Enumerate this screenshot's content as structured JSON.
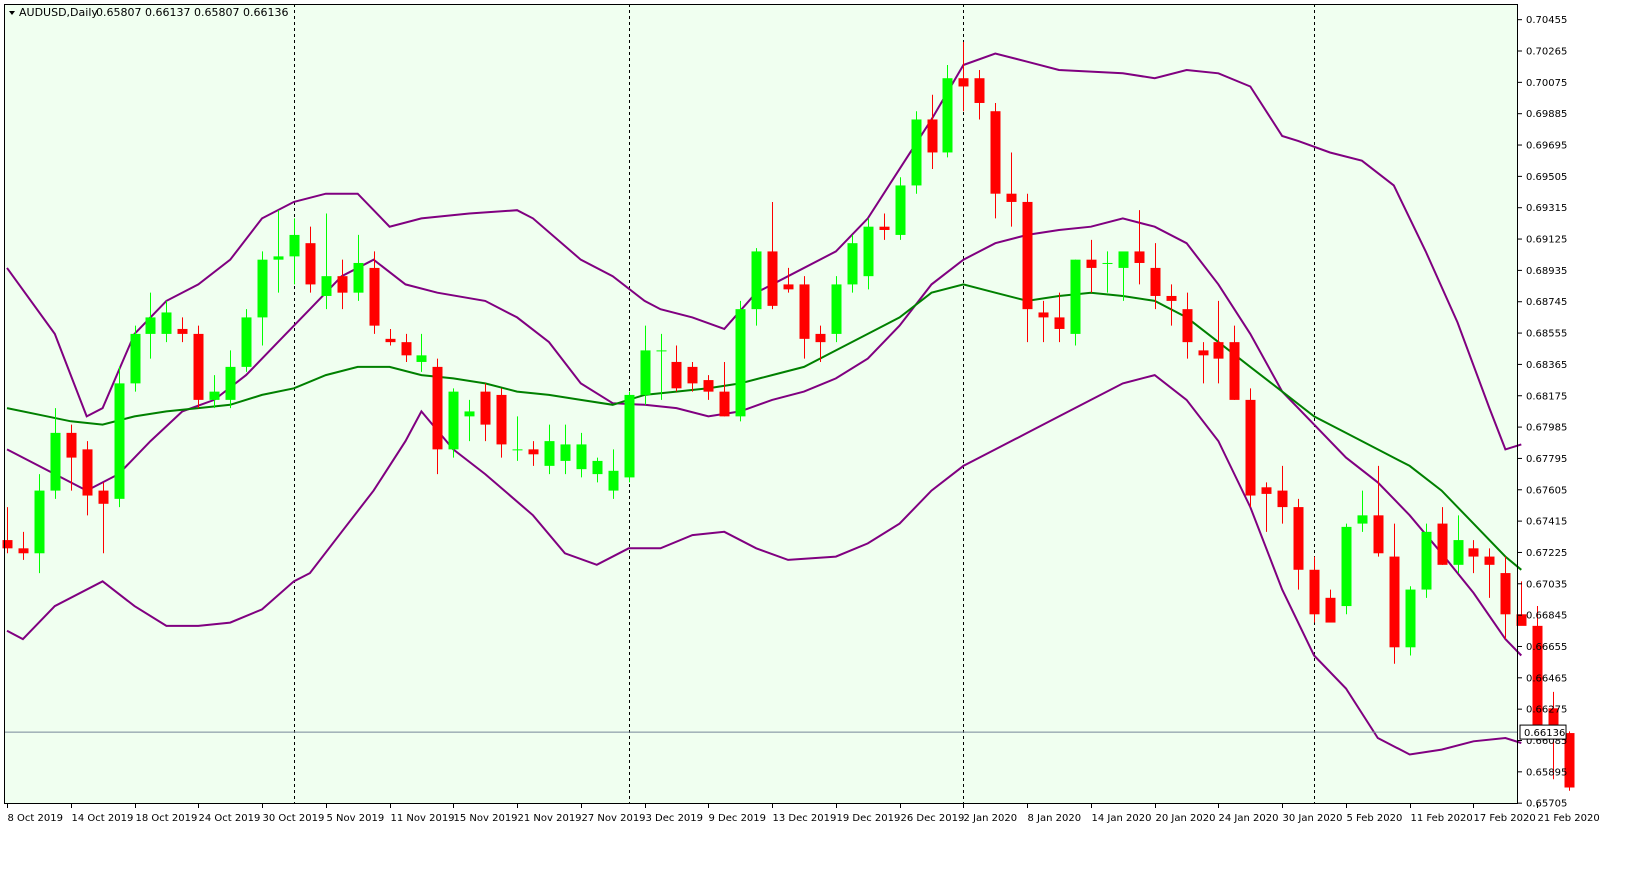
{
  "header": {
    "symbol": "AUDUSD,Daily",
    "ohlc": "0.65807 0.66137 0.65807 0.66136"
  },
  "colors": {
    "background": "#F0FFF0",
    "bull": "#00FF00",
    "bear": "#FF0000",
    "band": "#800080",
    "ma": "#008000",
    "grid": "#000000",
    "price_line": "#778899"
  },
  "chart_data": {
    "type": "candlestick",
    "title": "AUDUSD,Daily",
    "ylim": [
      0.657,
      0.7055
    ],
    "y_ticks": [
      "0.70455",
      "0.70265",
      "0.70075",
      "0.69885",
      "0.69695",
      "0.69505",
      "0.69315",
      "0.69125",
      "0.68935",
      "0.68745",
      "0.68555",
      "0.68365",
      "0.68175",
      "0.67985",
      "0.67795",
      "0.67605",
      "0.67415",
      "0.67225",
      "0.67035",
      "0.66845",
      "0.66655",
      "0.66465",
      "0.66275",
      "0.66085",
      "0.65895",
      "0.65705"
    ],
    "x_tick_labels": [
      "8 Oct 2019",
      "14 Oct 2019",
      "18 Oct 2019",
      "24 Oct 2019",
      "30 Oct 2019",
      "5 Nov 2019",
      "11 Nov 2019",
      "15 Nov 2019",
      "21 Nov 2019",
      "27 Nov 2019",
      "3 Dec 2019",
      "9 Dec 2019",
      "13 Dec 2019",
      "19 Dec 2019",
      "26 Dec 2019",
      "2 Jan 2020",
      "8 Jan 2020",
      "14 Jan 2020",
      "20 Jan 2020",
      "24 Jan 2020",
      "30 Jan 2020",
      "5 Feb 2020",
      "11 Feb 2020",
      "17 Feb 2020",
      "21 Feb 2020"
    ],
    "x_tick_index": [
      0,
      4,
      8,
      12,
      16,
      20,
      24,
      28,
      32,
      36,
      40,
      44,
      48,
      52,
      56,
      60,
      64,
      68,
      72,
      76,
      80,
      84,
      88,
      92,
      96
    ],
    "separators_index": [
      18,
      39,
      60,
      82
    ],
    "last_price": "0.66136",
    "last_price_value": 0.66136,
    "candles": [
      [
        0.673,
        0.675,
        0.6722,
        0.6725
      ],
      [
        0.6725,
        0.6735,
        0.6718,
        0.6722
      ],
      [
        0.6722,
        0.677,
        0.671,
        0.676
      ],
      [
        0.676,
        0.681,
        0.6755,
        0.6795
      ],
      [
        0.6795,
        0.68,
        0.676,
        0.678
      ],
      [
        0.6785,
        0.679,
        0.6745,
        0.6757
      ],
      [
        0.676,
        0.6765,
        0.6722,
        0.6752
      ],
      [
        0.6755,
        0.6835,
        0.675,
        0.6825
      ],
      [
        0.6825,
        0.686,
        0.682,
        0.6855
      ],
      [
        0.6855,
        0.688,
        0.684,
        0.6865
      ],
      [
        0.6855,
        0.6875,
        0.685,
        0.6868
      ],
      [
        0.6858,
        0.6865,
        0.685,
        0.6855
      ],
      [
        0.6855,
        0.686,
        0.681,
        0.6815
      ],
      [
        0.6815,
        0.683,
        0.681,
        0.682
      ],
      [
        0.6815,
        0.6845,
        0.681,
        0.6835
      ],
      [
        0.6835,
        0.687,
        0.6832,
        0.6865
      ],
      [
        0.6865,
        0.6905,
        0.6848,
        0.69
      ],
      [
        0.69,
        0.693,
        0.688,
        0.6902
      ],
      [
        0.6902,
        0.6925,
        0.6885,
        0.6915
      ],
      [
        0.691,
        0.692,
        0.688,
        0.6885
      ],
      [
        0.6878,
        0.6928,
        0.687,
        0.689
      ],
      [
        0.689,
        0.69,
        0.687,
        0.688
      ],
      [
        0.688,
        0.6915,
        0.6875,
        0.6898
      ],
      [
        0.6895,
        0.6905,
        0.6855,
        0.686
      ],
      [
        0.6852,
        0.6858,
        0.6848,
        0.685
      ],
      [
        0.685,
        0.6855,
        0.6838,
        0.6842
      ],
      [
        0.6838,
        0.6855,
        0.6832,
        0.6842
      ],
      [
        0.6835,
        0.684,
        0.677,
        0.6785
      ],
      [
        0.6785,
        0.6822,
        0.678,
        0.682
      ],
      [
        0.6805,
        0.6815,
        0.679,
        0.6808
      ],
      [
        0.682,
        0.6825,
        0.679,
        0.68
      ],
      [
        0.6818,
        0.6822,
        0.678,
        0.6788
      ],
      [
        0.6785,
        0.6805,
        0.6778,
        0.6785
      ],
      [
        0.6785,
        0.679,
        0.6775,
        0.6782
      ],
      [
        0.6775,
        0.68,
        0.677,
        0.679
      ],
      [
        0.6778,
        0.68,
        0.677,
        0.6788
      ],
      [
        0.6773,
        0.6795,
        0.6768,
        0.6788
      ],
      [
        0.677,
        0.678,
        0.6765,
        0.6778
      ],
      [
        0.676,
        0.6785,
        0.6755,
        0.6772
      ],
      [
        0.6768,
        0.682,
        0.6765,
        0.6818
      ],
      [
        0.6818,
        0.686,
        0.6812,
        0.6845
      ],
      [
        0.6845,
        0.6855,
        0.6815,
        0.6845
      ],
      [
        0.6838,
        0.6848,
        0.682,
        0.6822
      ],
      [
        0.6835,
        0.6838,
        0.682,
        0.6825
      ],
      [
        0.6827,
        0.683,
        0.6815,
        0.682
      ],
      [
        0.682,
        0.6838,
        0.6805,
        0.6805
      ],
      [
        0.6805,
        0.6875,
        0.6802,
        0.687
      ],
      [
        0.687,
        0.6907,
        0.686,
        0.6905
      ],
      [
        0.6905,
        0.6935,
        0.687,
        0.6872
      ],
      [
        0.6885,
        0.6895,
        0.688,
        0.6882
      ],
      [
        0.6885,
        0.689,
        0.684,
        0.6852
      ],
      [
        0.6855,
        0.686,
        0.6838,
        0.685
      ],
      [
        0.6855,
        0.689,
        0.685,
        0.6885
      ],
      [
        0.6885,
        0.6915,
        0.688,
        0.691
      ],
      [
        0.689,
        0.6925,
        0.6882,
        0.692
      ],
      [
        0.692,
        0.6928,
        0.6912,
        0.6918
      ],
      [
        0.6915,
        0.695,
        0.6912,
        0.6945
      ],
      [
        0.6945,
        0.699,
        0.694,
        0.6985
      ],
      [
        0.6985,
        0.7,
        0.6955,
        0.6965
      ],
      [
        0.6965,
        0.7018,
        0.6962,
        0.701
      ],
      [
        0.701,
        0.7032,
        0.699,
        0.7005
      ],
      [
        0.701,
        0.7015,
        0.6985,
        0.6995
      ],
      [
        0.699,
        0.6995,
        0.6925,
        0.694
      ],
      [
        0.694,
        0.6965,
        0.692,
        0.6935
      ],
      [
        0.6935,
        0.694,
        0.685,
        0.687
      ],
      [
        0.6868,
        0.6875,
        0.685,
        0.6865
      ],
      [
        0.6865,
        0.688,
        0.685,
        0.6858
      ],
      [
        0.6855,
        0.69,
        0.6848,
        0.69
      ],
      [
        0.69,
        0.6912,
        0.688,
        0.6895
      ],
      [
        0.6898,
        0.6905,
        0.688,
        0.6898
      ],
      [
        0.6895,
        0.69,
        0.6875,
        0.6905
      ],
      [
        0.6905,
        0.693,
        0.6885,
        0.6898
      ],
      [
        0.6895,
        0.691,
        0.687,
        0.6878
      ],
      [
        0.6878,
        0.6885,
        0.686,
        0.6875
      ],
      [
        0.687,
        0.688,
        0.684,
        0.685
      ],
      [
        0.6845,
        0.685,
        0.6825,
        0.6842
      ],
      [
        0.685,
        0.6875,
        0.6825,
        0.684
      ],
      [
        0.685,
        0.686,
        0.6815,
        0.6815
      ],
      [
        0.6815,
        0.6822,
        0.675,
        0.6757
      ],
      [
        0.6762,
        0.6765,
        0.6735,
        0.6758
      ],
      [
        0.676,
        0.6775,
        0.674,
        0.675
      ],
      [
        0.675,
        0.6755,
        0.67,
        0.6712
      ],
      [
        0.6712,
        0.672,
        0.668,
        0.6685
      ],
      [
        0.6695,
        0.67,
        0.668,
        0.668
      ],
      [
        0.669,
        0.674,
        0.6685,
        0.6738
      ],
      [
        0.674,
        0.676,
        0.6735,
        0.6745
      ],
      [
        0.6745,
        0.6775,
        0.672,
        0.6722
      ],
      [
        0.672,
        0.674,
        0.6655,
        0.6665
      ],
      [
        0.6665,
        0.6702,
        0.666,
        0.67
      ],
      [
        0.67,
        0.674,
        0.6695,
        0.6735
      ],
      [
        0.674,
        0.675,
        0.6715,
        0.6715
      ],
      [
        0.6715,
        0.6745,
        0.671,
        0.673
      ],
      [
        0.6725,
        0.673,
        0.671,
        0.672
      ],
      [
        0.672,
        0.6725,
        0.6695,
        0.6715
      ],
      [
        0.671,
        0.672,
        0.667,
        0.6685
      ],
      [
        0.6685,
        0.6705,
        0.668,
        0.6678
      ],
      [
        0.6678,
        0.669,
        0.661,
        0.6612
      ],
      [
        0.6628,
        0.6638,
        0.6585,
        0.6615
      ],
      [
        0.6613,
        0.6614,
        0.6578,
        0.658
      ]
    ],
    "bands": {
      "upper": [
        [
          0,
          0.6895
        ],
        [
          3,
          0.6855
        ],
        [
          5,
          0.6805
        ],
        [
          6,
          0.681
        ],
        [
          8,
          0.6855
        ],
        [
          10,
          0.6875
        ],
        [
          12,
          0.6885
        ],
        [
          14,
          0.69
        ],
        [
          16,
          0.6925
        ],
        [
          18,
          0.6935
        ],
        [
          20,
          0.694
        ],
        [
          22,
          0.694
        ],
        [
          24,
          0.692
        ],
        [
          26,
          0.6925
        ],
        [
          29,
          0.6928
        ],
        [
          32,
          0.693
        ],
        [
          33,
          0.6925
        ],
        [
          36,
          0.69
        ],
        [
          38,
          0.689
        ],
        [
          40,
          0.6875
        ],
        [
          41,
          0.687
        ],
        [
          43,
          0.6865
        ],
        [
          45,
          0.6858
        ],
        [
          47,
          0.688
        ],
        [
          49,
          0.689
        ],
        [
          52,
          0.6905
        ],
        [
          54,
          0.6925
        ],
        [
          56,
          0.6955
        ],
        [
          58,
          0.6985
        ],
        [
          60,
          0.7018
        ],
        [
          62,
          0.7025
        ],
        [
          64,
          0.702
        ],
        [
          66,
          0.7015
        ],
        [
          70,
          0.7013
        ],
        [
          72,
          0.701
        ],
        [
          74,
          0.7015
        ],
        [
          76,
          0.7013
        ],
        [
          78,
          0.7005
        ],
        [
          80,
          0.6975
        ],
        [
          81,
          0.6972
        ],
        [
          83,
          0.6965
        ],
        [
          85,
          0.696
        ],
        [
          87,
          0.6945
        ],
        [
          89,
          0.6905
        ],
        [
          91,
          0.6862
        ],
        [
          93,
          0.681
        ],
        [
          94,
          0.6785
        ],
        [
          95,
          0.6788
        ]
      ],
      "lower": [
        [
          0,
          0.6675
        ],
        [
          1,
          0.667
        ],
        [
          3,
          0.669
        ],
        [
          6,
          0.6705
        ],
        [
          8,
          0.669
        ],
        [
          10,
          0.6678
        ],
        [
          12,
          0.6678
        ],
        [
          14,
          0.668
        ],
        [
          16,
          0.6688
        ],
        [
          18,
          0.6705
        ],
        [
          19,
          0.671
        ],
        [
          21,
          0.6735
        ],
        [
          23,
          0.676
        ],
        [
          25,
          0.679
        ],
        [
          26,
          0.6808
        ],
        [
          28,
          0.6785
        ],
        [
          30,
          0.677
        ],
        [
          33,
          0.6745
        ],
        [
          35,
          0.6722
        ],
        [
          37,
          0.6715
        ],
        [
          39,
          0.6725
        ],
        [
          41,
          0.6725
        ],
        [
          43,
          0.6733
        ],
        [
          45,
          0.6735
        ],
        [
          47,
          0.6725
        ],
        [
          49,
          0.6718
        ],
        [
          52,
          0.672
        ],
        [
          54,
          0.6728
        ],
        [
          56,
          0.674
        ],
        [
          58,
          0.676
        ],
        [
          60,
          0.6775
        ],
        [
          62,
          0.6785
        ],
        [
          64,
          0.6795
        ],
        [
          66,
          0.6805
        ],
        [
          68,
          0.6815
        ],
        [
          70,
          0.6825
        ],
        [
          72,
          0.683
        ],
        [
          74,
          0.6815
        ],
        [
          76,
          0.679
        ],
        [
          78,
          0.675
        ],
        [
          80,
          0.67
        ],
        [
          82,
          0.666
        ],
        [
          84,
          0.664
        ],
        [
          86,
          0.661
        ],
        [
          88,
          0.66
        ],
        [
          90,
          0.6603
        ],
        [
          92,
          0.6608
        ],
        [
          94,
          0.661
        ],
        [
          95,
          0.6607
        ]
      ],
      "upper2": [
        [
          0,
          0.6785
        ],
        [
          2,
          0.6775
        ],
        [
          5,
          0.676
        ],
        [
          7,
          0.677
        ],
        [
          9,
          0.679
        ],
        [
          11,
          0.6808
        ],
        [
          13,
          0.6815
        ],
        [
          15,
          0.683
        ],
        [
          17,
          0.685
        ],
        [
          19,
          0.687
        ],
        [
          21,
          0.689
        ],
        [
          23,
          0.69
        ],
        [
          25,
          0.6885
        ],
        [
          27,
          0.688
        ],
        [
          30,
          0.6875
        ],
        [
          32,
          0.6865
        ],
        [
          34,
          0.685
        ],
        [
          36,
          0.6825
        ],
        [
          38,
          0.6813
        ],
        [
          40,
          0.6812
        ],
        [
          42,
          0.681
        ],
        [
          44,
          0.6805
        ],
        [
          46,
          0.6808
        ],
        [
          48,
          0.6815
        ],
        [
          50,
          0.682
        ],
        [
          52,
          0.6828
        ],
        [
          54,
          0.684
        ],
        [
          56,
          0.686
        ],
        [
          58,
          0.6885
        ],
        [
          60,
          0.69
        ],
        [
          62,
          0.691
        ],
        [
          64,
          0.6915
        ],
        [
          66,
          0.6918
        ],
        [
          68,
          0.692
        ],
        [
          70,
          0.6925
        ],
        [
          72,
          0.692
        ],
        [
          74,
          0.691
        ],
        [
          76,
          0.6885
        ],
        [
          78,
          0.6855
        ],
        [
          80,
          0.682
        ],
        [
          82,
          0.68
        ],
        [
          84,
          0.678
        ],
        [
          86,
          0.6765
        ],
        [
          88,
          0.6745
        ],
        [
          90,
          0.6722
        ],
        [
          92,
          0.6698
        ],
        [
          94,
          0.667
        ],
        [
          95,
          0.666
        ]
      ]
    },
    "ma": [
      [
        0,
        0.681
      ],
      [
        2,
        0.6806
      ],
      [
        4,
        0.6802
      ],
      [
        6,
        0.68
      ],
      [
        8,
        0.6805
      ],
      [
        10,
        0.6808
      ],
      [
        12,
        0.681
      ],
      [
        14,
        0.6812
      ],
      [
        16,
        0.6818
      ],
      [
        18,
        0.6822
      ],
      [
        20,
        0.683
      ],
      [
        22,
        0.6835
      ],
      [
        24,
        0.6835
      ],
      [
        26,
        0.683
      ],
      [
        28,
        0.6828
      ],
      [
        30,
        0.6825
      ],
      [
        32,
        0.682
      ],
      [
        34,
        0.6818
      ],
      [
        36,
        0.6815
      ],
      [
        38,
        0.6812
      ],
      [
        40,
        0.6818
      ],
      [
        42,
        0.682
      ],
      [
        44,
        0.6822
      ],
      [
        46,
        0.6825
      ],
      [
        48,
        0.683
      ],
      [
        50,
        0.6835
      ],
      [
        52,
        0.6845
      ],
      [
        54,
        0.6855
      ],
      [
        56,
        0.6865
      ],
      [
        58,
        0.688
      ],
      [
        60,
        0.6885
      ],
      [
        62,
        0.688
      ],
      [
        64,
        0.6875
      ],
      [
        66,
        0.6878
      ],
      [
        68,
        0.688
      ],
      [
        70,
        0.6878
      ],
      [
        72,
        0.6875
      ],
      [
        74,
        0.6865
      ],
      [
        76,
        0.685
      ],
      [
        78,
        0.6835
      ],
      [
        80,
        0.682
      ],
      [
        82,
        0.6805
      ],
      [
        84,
        0.6795
      ],
      [
        86,
        0.6785
      ],
      [
        88,
        0.6775
      ],
      [
        90,
        0.676
      ],
      [
        92,
        0.674
      ],
      [
        94,
        0.672
      ],
      [
        95,
        0.6712
      ]
    ]
  }
}
